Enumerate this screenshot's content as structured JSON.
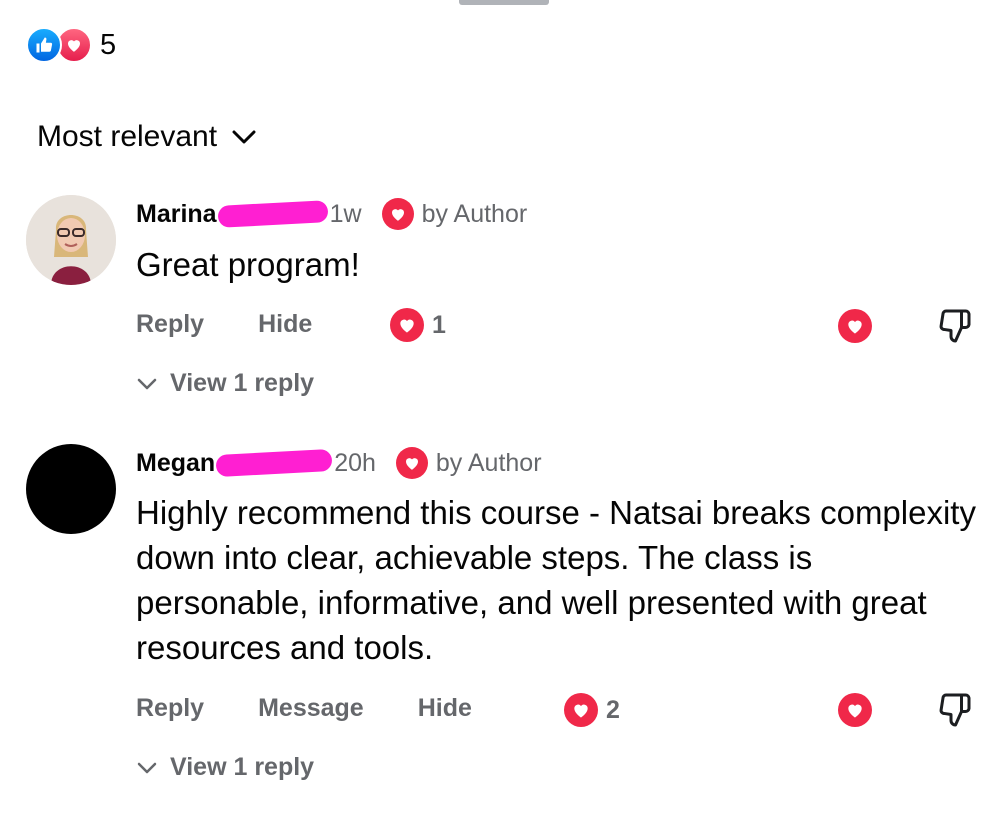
{
  "reactions": {
    "count": "5",
    "icons": [
      "like-icon",
      "love-icon"
    ]
  },
  "sort": {
    "label": "Most relevant"
  },
  "comments": [
    {
      "author": "Marina",
      "time": "1w",
      "author_badge": "by Author",
      "text": "Great program!",
      "actions": [
        "Reply",
        "Hide"
      ],
      "reaction_count": "1",
      "view_replies": "View 1 reply"
    },
    {
      "author": "Megan",
      "time": "20h",
      "author_badge": "by Author",
      "text": "Highly recommend this course - Natsai breaks complexity down into clear, achievable steps. The class is personable, informative, and well presented with great resources and tools.",
      "actions": [
        "Reply",
        "Message",
        "Hide"
      ],
      "reaction_count": "2",
      "view_replies": "View 1 reply"
    }
  ],
  "colors": {
    "love": "#f02849",
    "like": "#0866ff",
    "muted": "#65676b",
    "redaction": "#ff1fd2"
  }
}
